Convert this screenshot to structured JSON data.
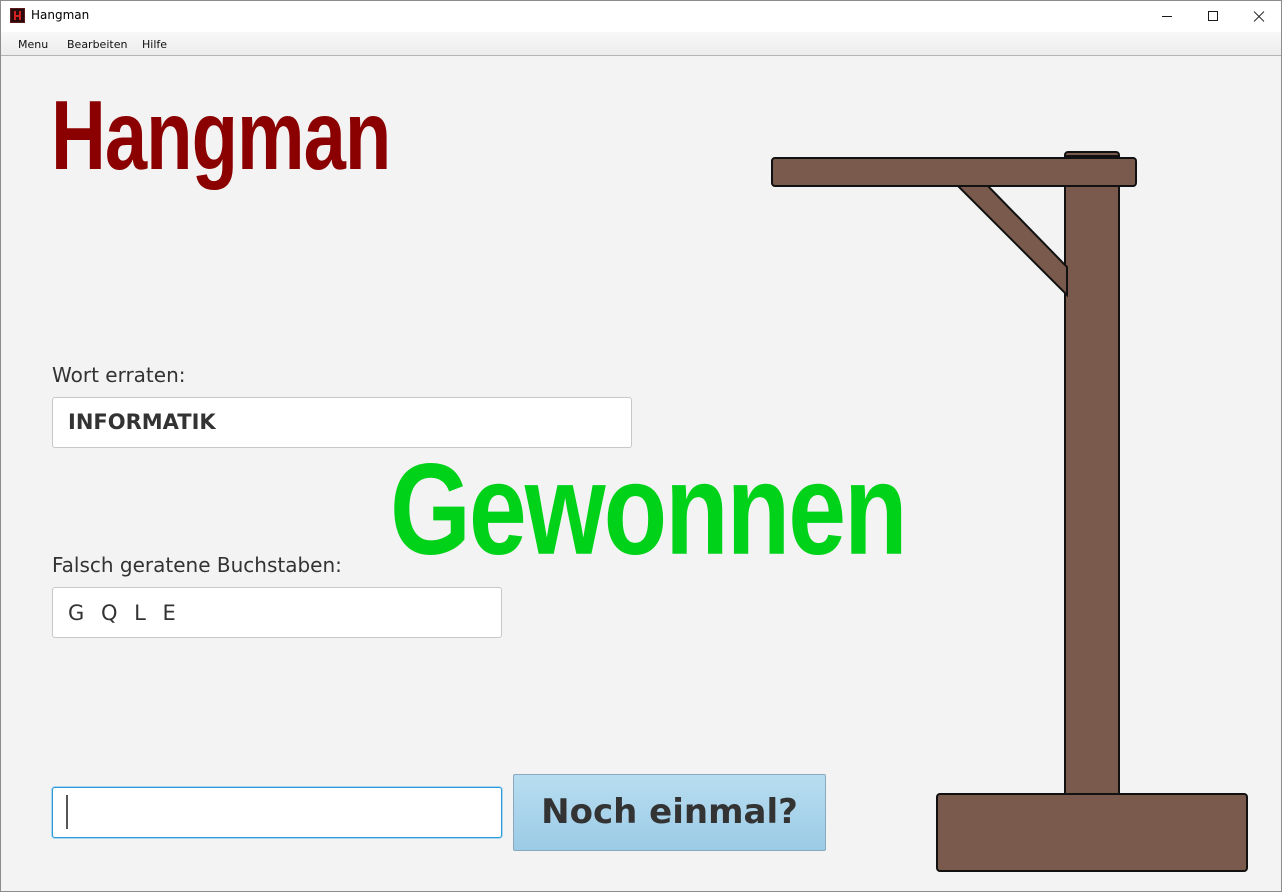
{
  "window": {
    "title": "Hangman"
  },
  "menu": {
    "items": [
      "Menu",
      "Bearbeiten",
      "Hilfe"
    ]
  },
  "game": {
    "heading": "Hangman",
    "word_label": "Wort erraten:",
    "word_value": "INFORMATIK",
    "wrong_label": "Falsch geratene Buchstaben:",
    "wrong_value": "G Q L E",
    "guess_value": "",
    "again_button": "Noch einmal?",
    "status": "Gewonnen"
  },
  "colors": {
    "heading": "#8b0000",
    "status": "#00d21a",
    "gallows_wood": "#7a5a4c",
    "button": "#a8d3ec"
  }
}
